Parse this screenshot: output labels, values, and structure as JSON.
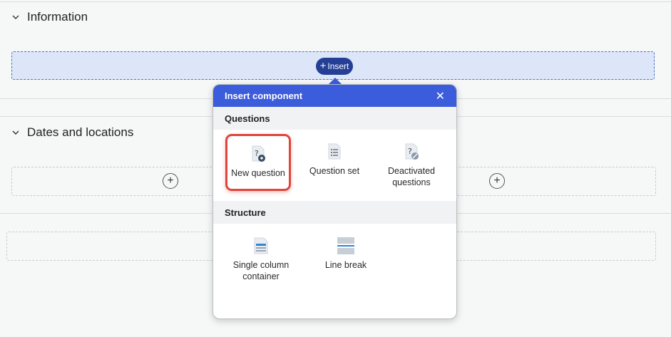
{
  "sections": [
    {
      "title": "Information"
    },
    {
      "title": "Dates and locations"
    }
  ],
  "insert_button": {
    "label": "Insert"
  },
  "popup": {
    "title": "Insert component",
    "groups": [
      {
        "title": "Questions",
        "items": [
          {
            "label": "New question",
            "icon": "new-question-icon",
            "selected": true
          },
          {
            "label": "Question set",
            "icon": "question-set-icon"
          },
          {
            "label": "Deactivated questions",
            "icon": "deactivated-questions-icon"
          }
        ]
      },
      {
        "title": "Structure",
        "items": [
          {
            "label": "Single column container",
            "icon": "single-column-container-icon"
          },
          {
            "label": "Line break",
            "icon": "line-break-icon"
          }
        ]
      }
    ]
  },
  "colors": {
    "accent": "#3b5cdb",
    "insert_button": "#243f95",
    "highlight": "#e0443a"
  }
}
